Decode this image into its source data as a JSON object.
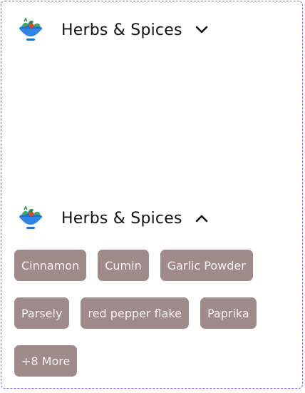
{
  "colors": {
    "frame_border": "#8a5cf6",
    "chip_bg": "#9e8b8a",
    "chip_text": "#f7f1f1",
    "bowl_blue": "#2f84e7",
    "leaf_green": "#2e8b57",
    "tomato_red": "#e4412b"
  },
  "sections": [
    {
      "icon": "salad-bowl-icon",
      "title": "Herbs & Spices",
      "chevron": "chevron-down-icon",
      "expanded": false
    },
    {
      "icon": "salad-bowl-icon",
      "title": "Herbs & Spices",
      "chevron": "chevron-up-icon",
      "expanded": true,
      "chips": [
        [
          "Cinnamon",
          "Cumin",
          "Garlic Powder"
        ],
        [
          "Parsely",
          "red pepper flake",
          "Paprika"
        ],
        [
          "+8 More"
        ]
      ]
    }
  ]
}
